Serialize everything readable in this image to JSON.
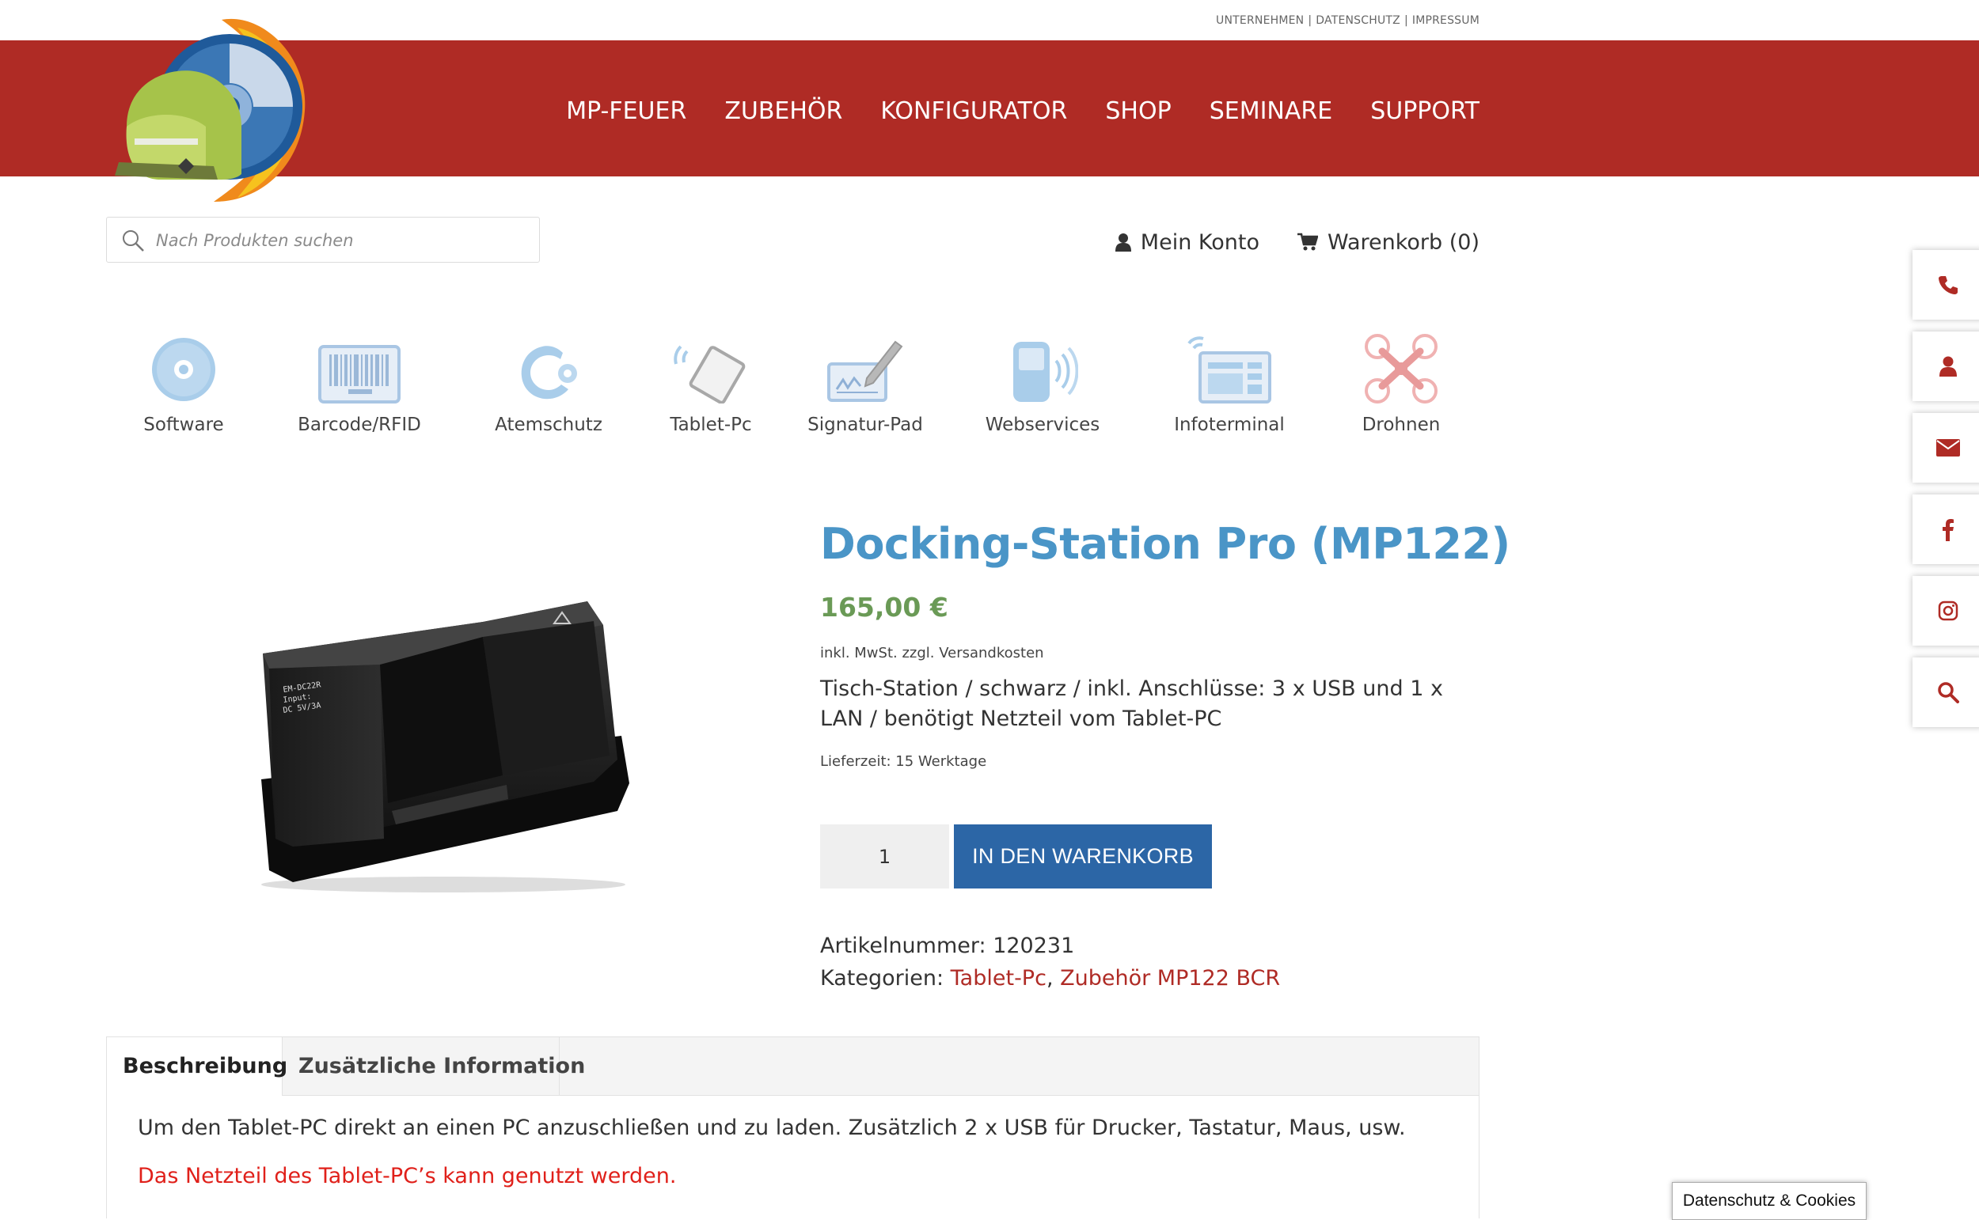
{
  "top_links": {
    "unternehmen": "UNTERNEHMEN",
    "separator": "|",
    "datenschutz": "DATENSCHUTZ",
    "impressum": "IMPRESSUM"
  },
  "nav": {
    "items": [
      "MP-FEUER",
      "ZUBEHÖR",
      "KONFIGURATOR",
      "SHOP",
      "SEMINARE",
      "SUPPORT"
    ]
  },
  "search": {
    "placeholder": "Nach Produkten suchen"
  },
  "account": {
    "label": "Mein Konto"
  },
  "cart": {
    "label": "Warenkorb (0)"
  },
  "categories": [
    {
      "label": "Software",
      "icon": "cd-icon"
    },
    {
      "label": "Barcode/RFID",
      "icon": "barcode-icon"
    },
    {
      "label": "Atemschutz",
      "icon": "atemschutz-icon"
    },
    {
      "label": "Tablet-Pc",
      "icon": "tablet-icon"
    },
    {
      "label": "Signatur-Pad",
      "icon": "signature-pad-icon"
    },
    {
      "label": "Webservices",
      "icon": "webservices-icon"
    },
    {
      "label": "Infoterminal",
      "icon": "infoterminal-icon"
    },
    {
      "label": "Drohnen",
      "icon": "drone-icon"
    }
  ],
  "product": {
    "title": "Docking-Station Pro (MP122)",
    "price": "165,00 €",
    "tax_note": "inkl. MwSt. zzgl. Versandkosten",
    "short_description": "Tisch-Station / schwarz / inkl. Anschlüsse: 3 x USB und 1 x LAN / benötigt Netzteil vom Tablet-PC",
    "delivery": "Lieferzeit: 15 Werktage",
    "quantity": "1",
    "add_to_cart": "IN DEN WARENKORB",
    "sku_label": "Artikelnummer:",
    "sku": "120231",
    "categories_label": "Kategorien:",
    "category_1": "Tablet-Pc",
    "category_sep": ",",
    "category_2": "Zubehör MP122 BCR"
  },
  "tabs": {
    "description": "Beschreibung",
    "additional": "Zusätzliche Information"
  },
  "description": {
    "text": "Um den Tablet-PC direkt an einen PC anzuschließen und zu laden. Zusätzlich 2 x USB für Drucker, Tastatur, Maus, usw.",
    "note": "Das Netzteil des Tablet-PC’s kann genutzt werden."
  },
  "side_buttons": [
    "phone-icon",
    "user-icon",
    "mail-icon",
    "facebook-icon",
    "instagram-icon",
    "search-icon"
  ],
  "cookie_button": "Datenschutz & Cookies",
  "colors": {
    "brand_red": "#af2b25",
    "title_blue": "#4a95c7",
    "price_green": "#6a9a56",
    "button_blue": "#2c66a6",
    "note_red": "#e0201a"
  }
}
